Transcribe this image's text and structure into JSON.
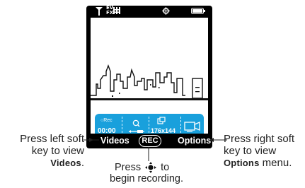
{
  "status_bar": {
    "signal_icon": "signal-antenna-icon",
    "network_label_top": "EV",
    "network_label_bottom": "FX",
    "grid_icon": "grid-icon",
    "nav_icon": "navigation-icon",
    "battery_icon": "battery-icon"
  },
  "recording_info": {
    "rec_label": "Rec",
    "time": "00:00",
    "zoom_icon": "zoom-icon",
    "resolution_icon": "resolution-icon",
    "resolution": "176x144",
    "camera_icon": "video-camera-icon"
  },
  "softkeys": {
    "left": "Videos",
    "center": "REC",
    "right": "Options"
  },
  "callouts": {
    "left_line1": "Press left soft",
    "left_line2": "key to view",
    "left_emph": "Videos",
    "left_suffix": ".",
    "right_line1": "Press right soft",
    "right_line2": "key to view",
    "right_emph": "Options",
    "right_suffix": " menu.",
    "center_line1_a": "Press",
    "center_line1_b": "to",
    "center_line2": "begin recording."
  },
  "colors": {
    "info_bar": "#19a0dc",
    "phone_body": "#000000"
  }
}
